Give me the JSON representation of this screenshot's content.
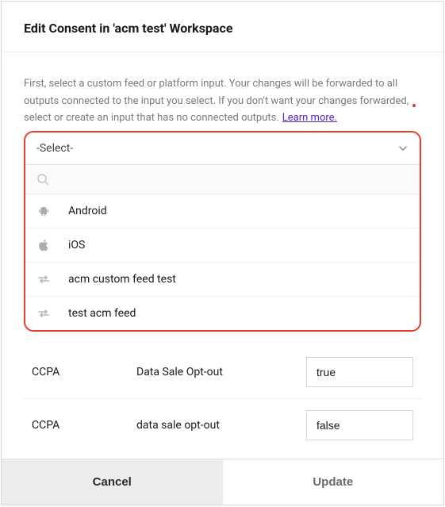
{
  "dialog": {
    "title": "Edit Consent in 'acm test' Workspace",
    "intro": "First, select a custom feed or platform input. Your changes will be forwarded to all outputs connected to the input you select. If you don't want your changes forwarded, select or create an input that has no connected outputs.",
    "learn_more": "Learn more."
  },
  "select": {
    "placeholder": "-Select-",
    "search_placeholder": "",
    "options": [
      {
        "label": "Android",
        "icon": "android-icon"
      },
      {
        "label": "iOS",
        "icon": "apple-icon"
      },
      {
        "label": "acm custom feed test",
        "icon": "swap-icon"
      },
      {
        "label": "test acm feed",
        "icon": "swap-icon"
      }
    ]
  },
  "consent_rows": [
    {
      "framework": "CCPA",
      "type": "Data Sale Opt-out",
      "value": "true"
    },
    {
      "framework": "CCPA",
      "type": "data sale opt-out",
      "value": "false"
    }
  ],
  "footer": {
    "cancel": "Cancel",
    "update": "Update"
  }
}
